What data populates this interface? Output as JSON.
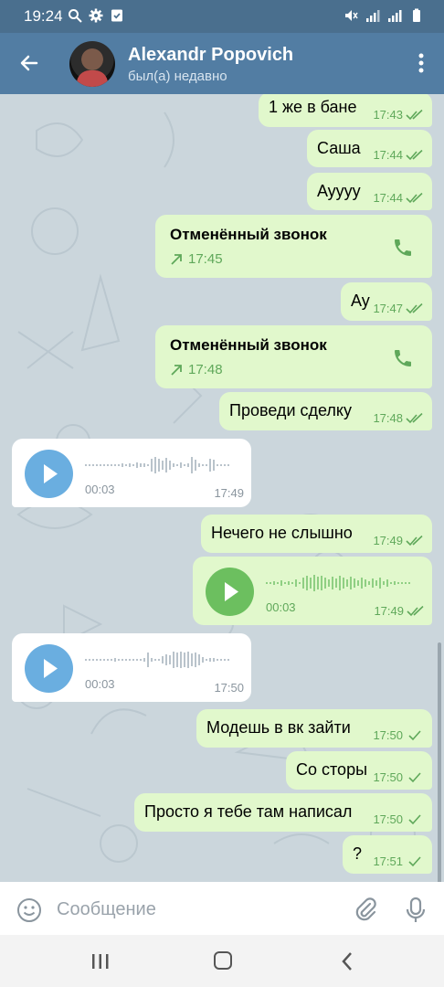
{
  "statusbar": {
    "time": "19:24"
  },
  "header": {
    "name": "Alexandr Popovich",
    "status": "был(а) недавно"
  },
  "messages": [
    {
      "text": "1 же в бане",
      "time": "17:43"
    },
    {
      "text": "Саша",
      "time": "17:44"
    },
    {
      "text": "Ayyyy",
      "time": "17:44"
    },
    {
      "title": "Отменённый звонок",
      "time": "17:45"
    },
    {
      "text": "Ау",
      "time": "17:47"
    },
    {
      "title": "Отменённый звонок",
      "time": "17:48"
    },
    {
      "text": "Проведи сделку",
      "time": "17:48"
    },
    {
      "duration": "00:03",
      "time": "17:49"
    },
    {
      "text": "Нечего не слышно",
      "time": "17:49"
    },
    {
      "duration": "00:03",
      "time": "17:49"
    },
    {
      "duration": "00:03",
      "time": "17:50"
    },
    {
      "text": "Модешь в вк зайти",
      "time": "17:50"
    },
    {
      "text": "Со сторы",
      "time": "17:50"
    },
    {
      "text": "Просто я тебе там написал",
      "time": "17:50"
    },
    {
      "text": "?",
      "time": "17:51"
    }
  ],
  "input": {
    "placeholder": "Сообщение"
  },
  "colors": {
    "header": "#527da3",
    "statusbar": "#4a6f8e",
    "outgoing": "#e1f8cc",
    "incoming": "#ffffff",
    "accent_green": "#5fa85a",
    "play_blue": "#6aaee0",
    "play_green": "#6cbf5f"
  },
  "icons": [
    "back-arrow-icon",
    "more-vert-icon",
    "double-check-icon",
    "single-check-icon",
    "phone-icon",
    "outgoing-arrow-icon",
    "play-icon",
    "emoji-icon",
    "attach-icon",
    "mic-icon"
  ]
}
